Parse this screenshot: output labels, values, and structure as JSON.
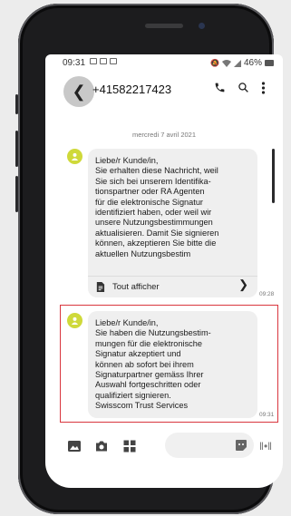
{
  "status_bar": {
    "time": "09:31",
    "battery": "46%"
  },
  "header": {
    "contact": "+41582217423"
  },
  "conversation": {
    "date": "mercredi 7 avril 2021",
    "messages": [
      {
        "text": "Liebe/r Kunde/in,\nSie erhalten diese Nachricht, weil\nSie sich bei unserem Identifika-\ntionspartner oder RA Agenten\nfür die elektronische Signatur\nidentifiziert haben, oder weil wir\nunsere Nutzungsbestimmungen\naktualisieren. Damit Sie signieren\nkönnen, akzeptieren Sie bitte die\naktuellen Nutzungsbestim",
        "show_all": "Tout afficher",
        "time": "09:28"
      },
      {
        "text": "Liebe/r Kunde/in,\nSie haben die Nutzungsbestim-\nmungen für die elektronische\nSignatur akzeptiert und\nkönnen ab sofort bei ihrem\nSignaturpartner gemäss Ihrer\nAuswahl fortgeschritten oder\nqualifiziert signieren.\nSwisscom Trust Services",
        "time": "09:31"
      }
    ]
  },
  "colors": {
    "highlight": "#d9363e",
    "avatar": "#cfd93a",
    "bubble": "#efefef"
  }
}
